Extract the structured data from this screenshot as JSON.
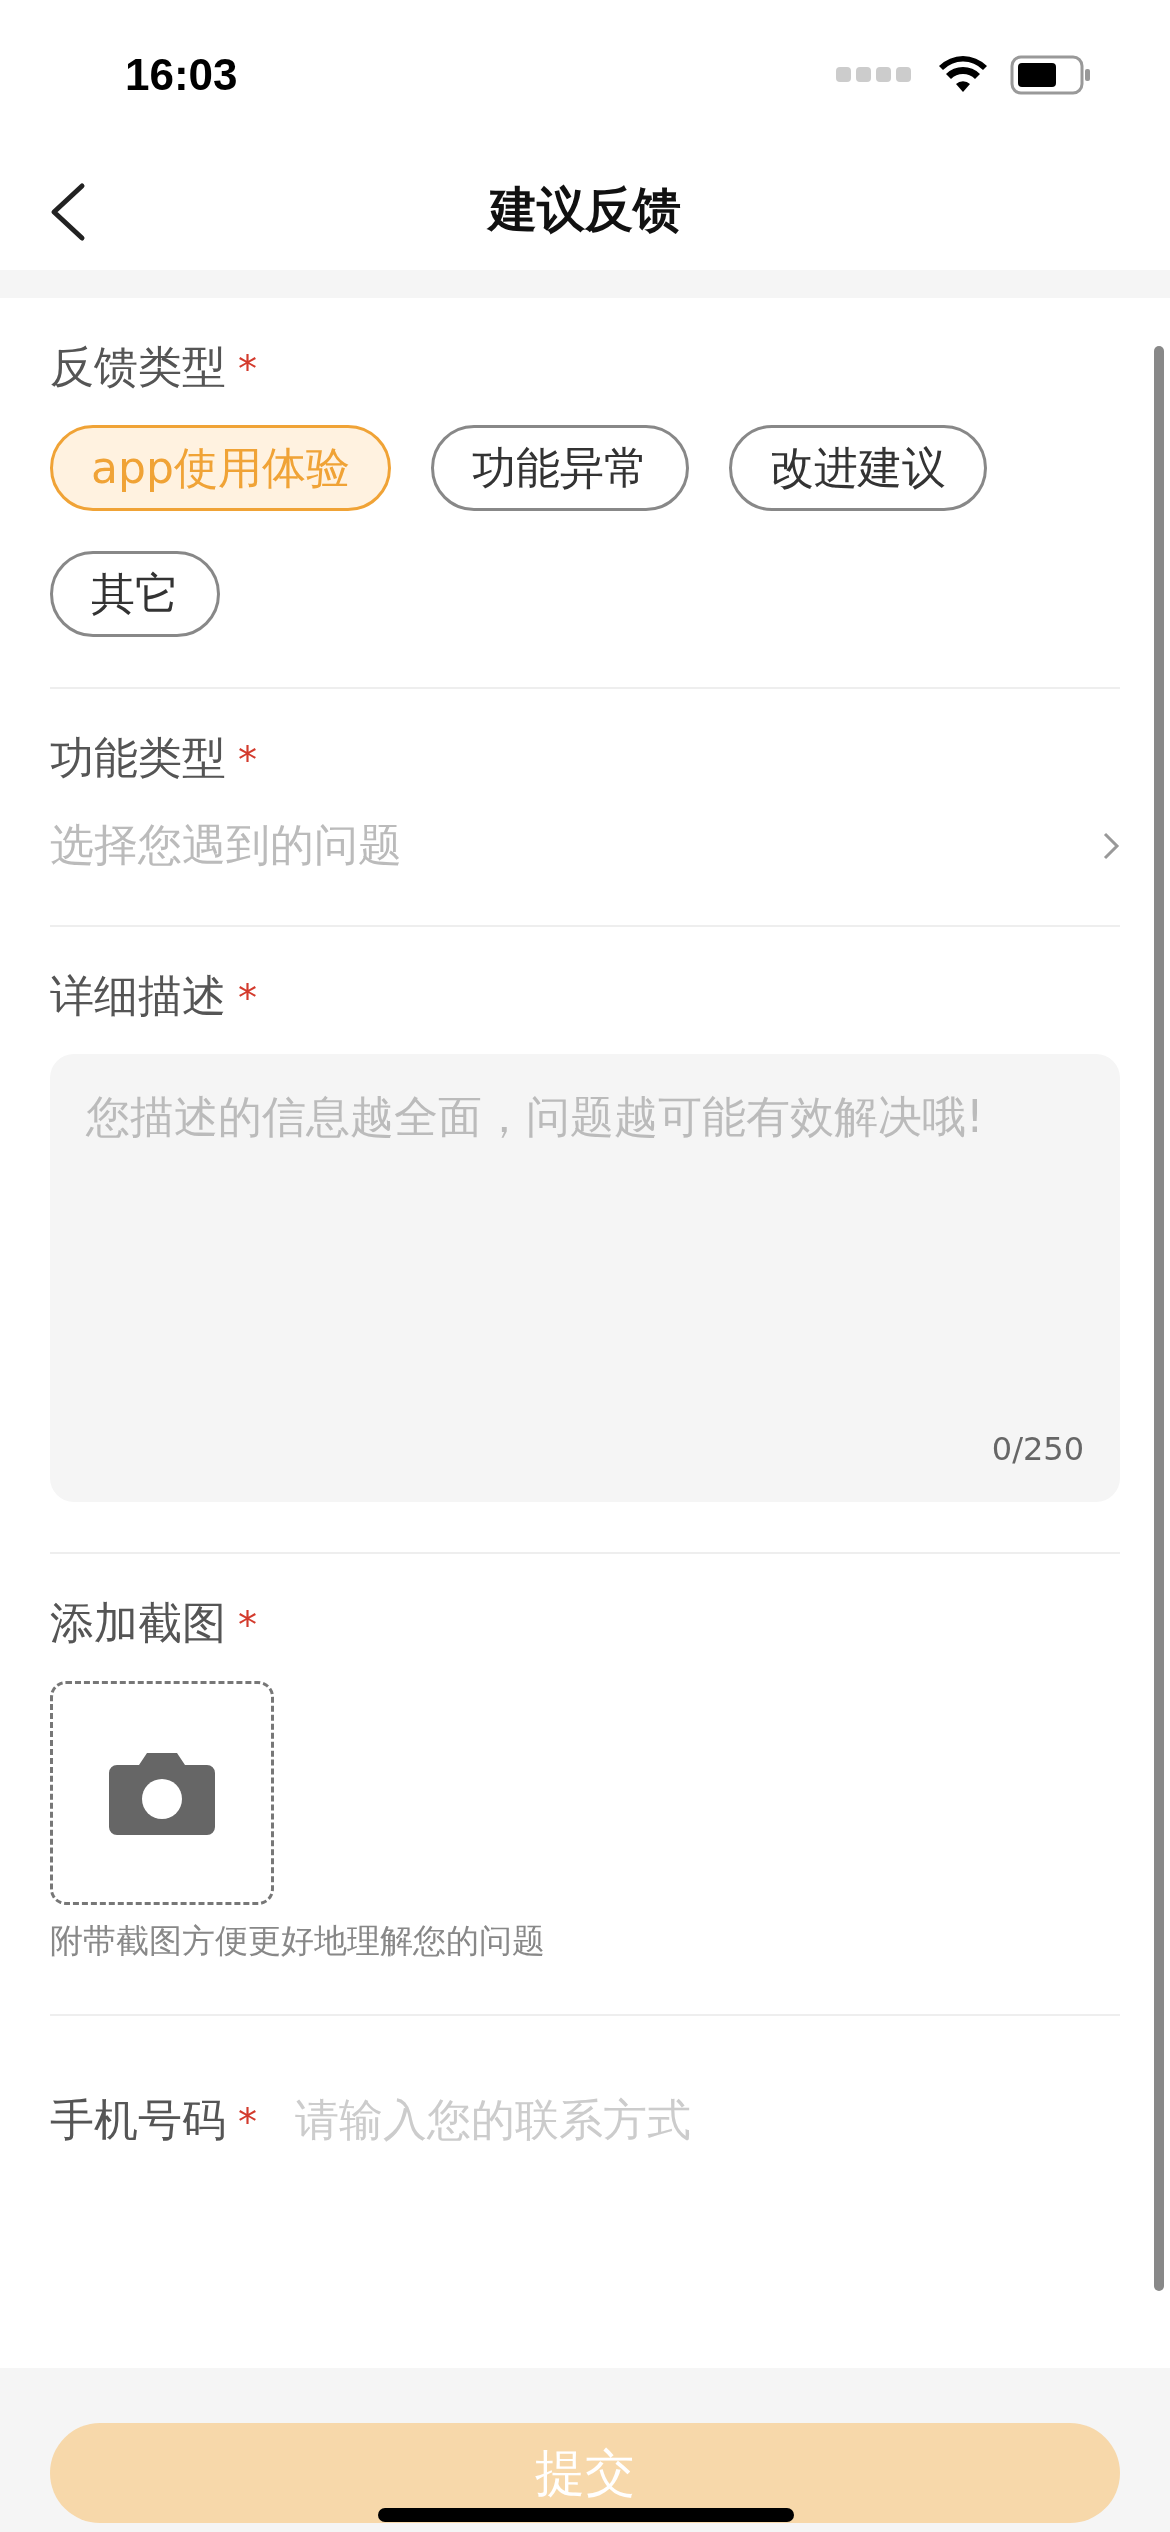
{
  "status_bar": {
    "time": "16:03"
  },
  "nav": {
    "title": "建议反馈"
  },
  "feedback_type": {
    "label": "反馈类型",
    "required_mark": "*",
    "options": [
      {
        "label": "app使用体验",
        "selected": true
      },
      {
        "label": "功能异常",
        "selected": false
      },
      {
        "label": "改进建议",
        "selected": false
      },
      {
        "label": "其它",
        "selected": false
      }
    ]
  },
  "function_type": {
    "label": "功能类型",
    "required_mark": "*",
    "placeholder": "选择您遇到的问题"
  },
  "description": {
    "label": "详细描述",
    "required_mark": "*",
    "placeholder": "您描述的信息越全面，问题越可能有效解决哦!",
    "counter": "0/250"
  },
  "screenshot": {
    "label": "添加截图",
    "required_mark": "*",
    "hint": "附带截图方便更好地理解您的问题"
  },
  "phone": {
    "label": "手机号码",
    "required_mark": "*",
    "placeholder": "请输入您的联系方式"
  },
  "submit": {
    "label": "提交"
  }
}
